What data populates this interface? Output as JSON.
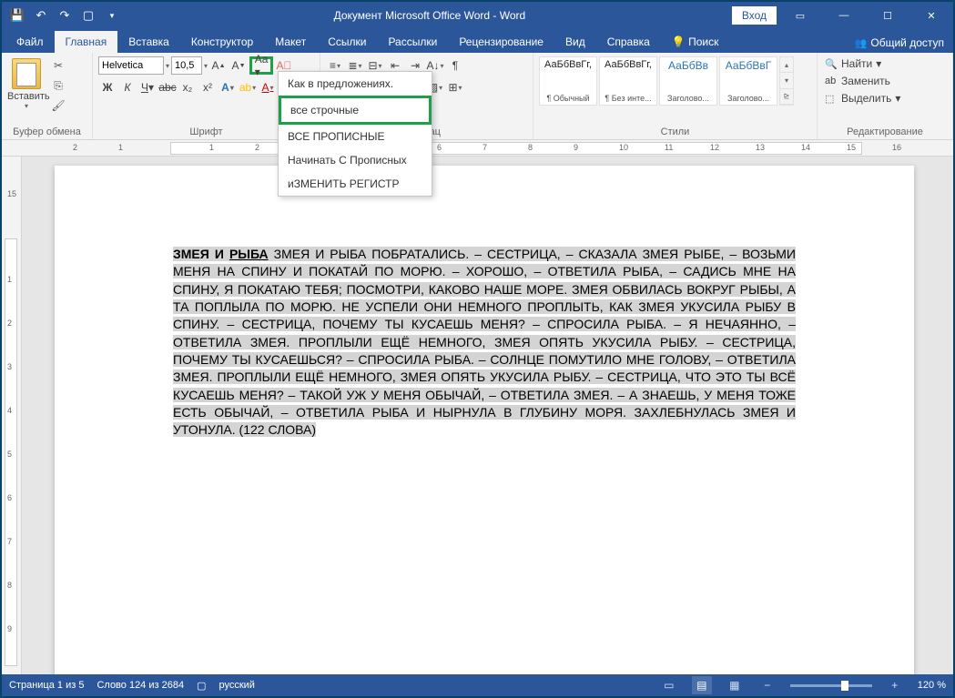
{
  "title": "Документ Microsoft Office Word  -  Word",
  "signin": "Вход",
  "tabs": {
    "file": "Файл",
    "home": "Главная",
    "insert": "Вставка",
    "design": "Конструктор",
    "layout": "Макет",
    "references": "Ссылки",
    "mailings": "Рассылки",
    "review": "Рецензирование",
    "view": "Вид",
    "help": "Справка",
    "search": "Поиск",
    "share": "Общий доступ"
  },
  "groups": {
    "clipboard": "Буфер обмена",
    "font": "Шрифт",
    "paragraph": "Абзац",
    "styles": "Стили",
    "editing": "Редактирование"
  },
  "clipboard": {
    "paste": "Вставить"
  },
  "font": {
    "name": "Helvetica",
    "size": "10,5"
  },
  "case_menu": {
    "sentence": "Как в предложениях.",
    "lower": "все строчные",
    "upper": "ВСЕ ПРОПИСНЫЕ",
    "capitalize": "Начинать С Прописных",
    "toggle": "иЗМЕНИТЬ РЕГИСТР"
  },
  "styles": [
    {
      "preview": "АаБбВвГг,",
      "name": "¶ Обычный"
    },
    {
      "preview": "АаБбВвГг,",
      "name": "¶ Без инте..."
    },
    {
      "preview": "АаБбВв",
      "name": "Заголово..."
    },
    {
      "preview": "АаБбВвГ",
      "name": "Заголово..."
    }
  ],
  "editing": {
    "find": "Найти",
    "replace": "Заменить",
    "select": "Выделить"
  },
  "document": {
    "bold_part": "ЗМЕЯ И ",
    "bold_underline": "РЫБА",
    "rest": " ЗМЕЯ И РЫБА ПОБРАТАЛИСЬ. – СЕСТРИЦА, – СКАЗАЛА ЗМЕЯ РЫБЕ, – ВОЗЬМИ МЕНЯ НА СПИНУ И ПОКАТАЙ ПО МОРЮ. – ХОРОШО, – ОТВЕТИЛА РЫБА, – САДИСЬ МНЕ НА СПИНУ, Я ПОКАТАЮ ТЕБЯ; ПОСМОТРИ, КАКОВО НАШЕ МОРЕ. ЗМЕЯ ОБВИЛАСЬ ВОКРУГ РЫБЫ, А ТА ПОПЛЫЛА ПО МОРЮ. НЕ УСПЕЛИ ОНИ НЕМНОГО ПРОПЛЫТЬ, КАК ЗМЕЯ УКУСИЛА РЫБУ В СПИНУ. – СЕСТРИЦА, ПОЧЕМУ ТЫ КУСАЕШЬ МЕНЯ? – СПРОСИЛА РЫБА. – Я НЕЧАЯННО, – ОТВЕТИЛА ЗМЕЯ. ПРОПЛЫЛИ ЕЩЁ НЕМНОГО, ЗМЕЯ ОПЯТЬ УКУСИЛА РЫБУ. – СЕСТРИЦА, ПОЧЕМУ ТЫ КУСАЕШЬСЯ? – СПРОСИЛА РЫБА. – СОЛНЦЕ ПОМУТИЛО МНЕ ГОЛОВУ, – ОТВЕТИЛА ЗМЕЯ. ПРОПЛЫЛИ ЕЩЁ НЕМНОГО, ЗМЕЯ ОПЯТЬ УКУСИЛА РЫБУ. – СЕСТРИЦА, ЧТО ЭТО ТЫ ВСЁ КУСАЕШЬ МЕНЯ? – ТАКОЙ УЖ У МЕНЯ ОБЫЧАЙ, – ОТВЕТИЛА ЗМЕЯ. – А ЗНАЕШЬ, У МЕНЯ ТОЖЕ ЕСТЬ ОБЫЧАЙ, – ОТВЕТИЛА РЫБА И НЫРНУЛА В ГЛУБИНУ МОРЯ. ЗАХЛЕБНУЛАСЬ ЗМЕЯ И УТОНУЛА. (122 СЛОВА)"
  },
  "status": {
    "page": "Страница 1 из 5",
    "words": "Слово 124 из 2684",
    "lang": "русский",
    "zoom": "120 %"
  }
}
